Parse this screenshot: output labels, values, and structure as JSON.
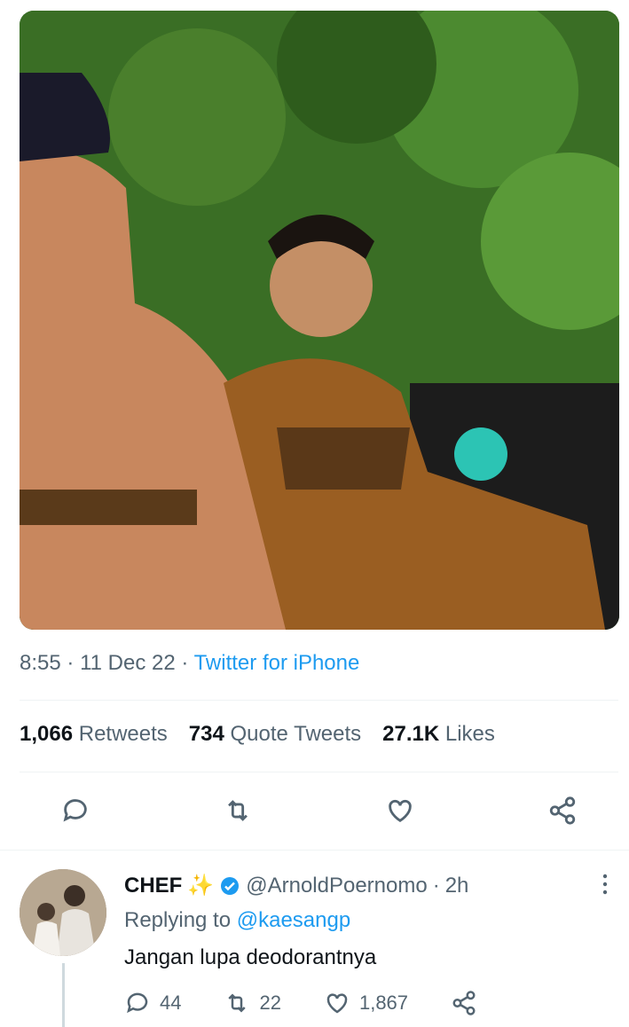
{
  "tweet": {
    "time": "8:55",
    "date": "11 Dec 22",
    "source": "Twitter for iPhone",
    "stats": {
      "retweets_count": "1,066",
      "retweets_label": "Retweets",
      "quotes_count": "734",
      "quotes_label": "Quote Tweets",
      "likes_count": "27.1K",
      "likes_label": "Likes"
    }
  },
  "reply": {
    "name": "CHEF",
    "sparkle": "✨",
    "handle": "@ArnoldPoernomo",
    "time": "2h",
    "replying_label": "Replying to",
    "replying_to": "@kaesangp",
    "text": "Jangan lupa deodorantnya",
    "reply_count": "44",
    "retweet_count": "22",
    "like_count": "1,867"
  },
  "colors": {
    "link": "#1d9bf0",
    "muted": "#536471",
    "verified": "#1d9bf0"
  }
}
